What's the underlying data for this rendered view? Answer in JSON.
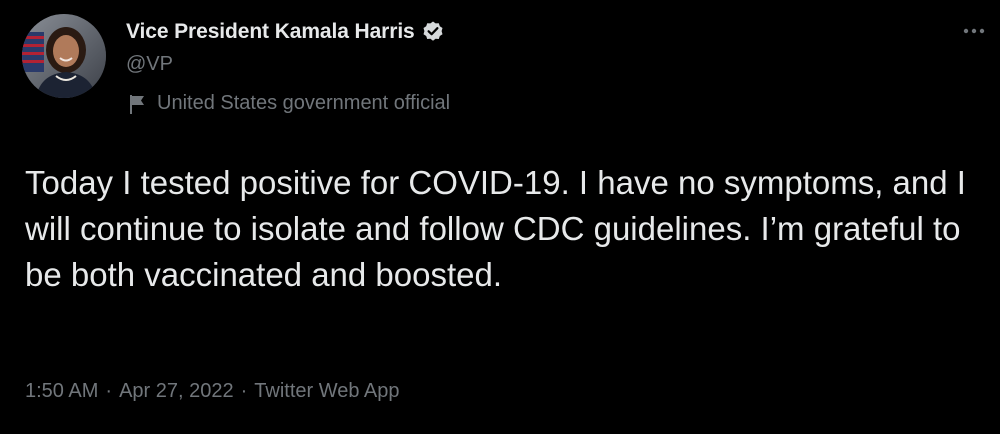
{
  "theme": {
    "background": "#000000",
    "text_primary": "#e7e9ea",
    "text_secondary": "#71767b",
    "verified_badge": "#d6d9db"
  },
  "author": {
    "display_name": "Vice President Kamala Harris",
    "handle": "@VP",
    "verified_icon": "verified-badge-icon",
    "label_icon": "flag-icon",
    "label": "United States government official"
  },
  "menu": {
    "icon": "more-icon"
  },
  "tweet": {
    "text": "Today I tested positive for COVID-19. I have no symptoms, and I will continue to isolate and follow CDC guidelines. I’m grateful to be both vaccinated and boosted.",
    "time": "1:50 AM",
    "date": "Apr 27, 2022",
    "source": "Twitter Web App",
    "separator": "·"
  }
}
